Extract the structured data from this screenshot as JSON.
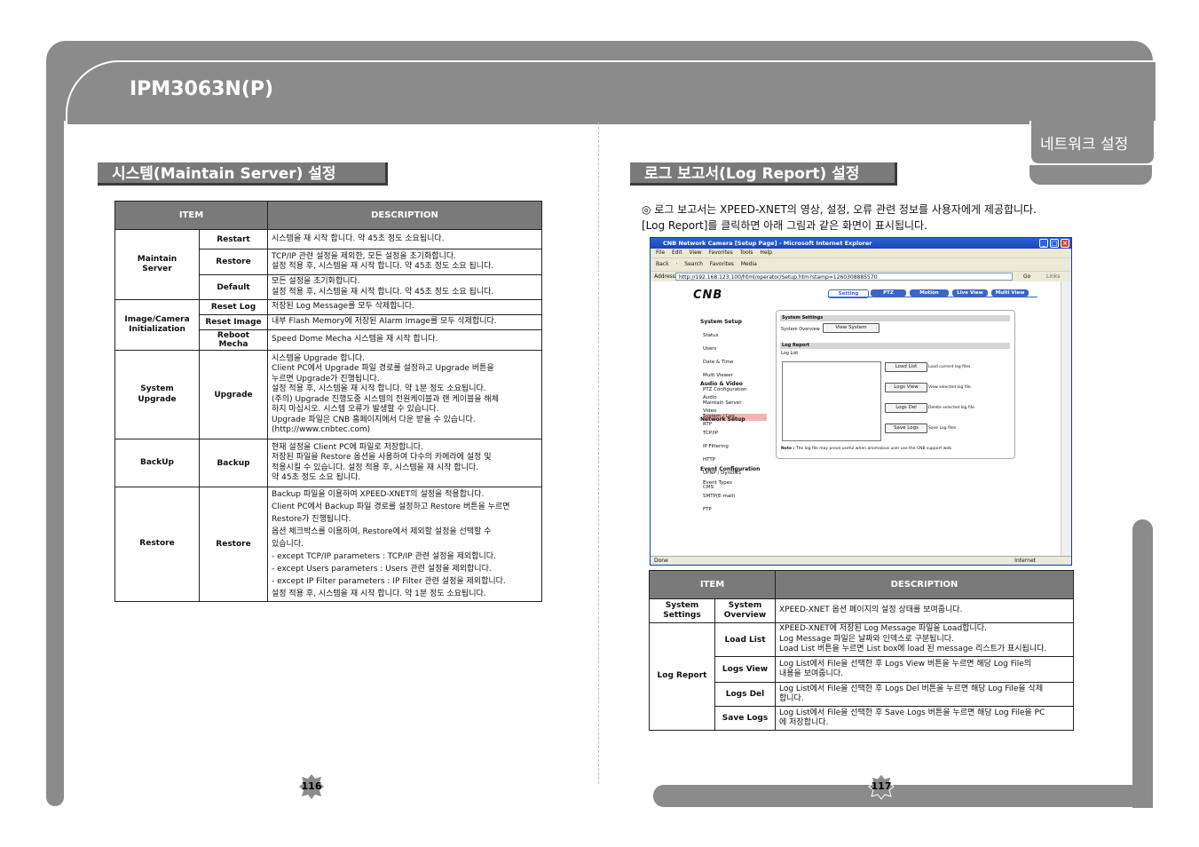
{
  "header": {
    "doc_title": "IPM3063N(P)",
    "tab_label": "네트워크 설정"
  },
  "left": {
    "section_title": "시스템(Maintain Server) 설정",
    "table": {
      "col_item": "ITEM",
      "col_desc": "DESCRIPTION",
      "groups": [
        {
          "group": "Maintain\nServer",
          "rows": [
            {
              "item": "Restart",
              "desc": "시스템을 재 시작 합니다. 약 45초 정도 소요됩니다."
            },
            {
              "item": "Restore",
              "desc": "TCP/IP 관련 설정을 제외한, 모든 설정을 초기화합니다.\n설정 적용 후, 시스템을 재 시작 합니다. 약 45초 정도 소요 됩니다."
            },
            {
              "item": "Default",
              "desc": "모든 설정을 초기화합니다.\n설정 적용 후, 시스템을 재 시작 합니다. 약 45초 정도 소요 됩니다."
            }
          ]
        },
        {
          "group": "Image/Camera\nInitialization",
          "rows": [
            {
              "item": "Reset Log",
              "desc": "저장된 Log Message를 모두 삭제합니다."
            },
            {
              "item": "Reset Image",
              "desc": "내부 Flash Memory에 저장된 Alarm Image를 모두 삭제합니다."
            },
            {
              "item": "Reboot Mecha",
              "desc": "Speed Dome Mecha 시스템을 재 시작 합니다."
            }
          ]
        },
        {
          "group": "System\nUpgrade",
          "rows": [
            {
              "item": "Upgrade",
              "desc": "시스템을 Upgrade 합니다.\nClient PC에서 Upgrade 파일 경로를 설정하고 Upgrade 버튼을\n누르면 Upgrade가 진행됩니다.\n설정 적용 후, 시스템을 재 시작 합니다. 약 1분 정도 소요됩니다.\n(주의) Upgrade 진행도중 시스템의 전원케이블과 랜 케이블을 해체\n하지 마십시오. 시스템 오류가 발생할 수 있습니다.\nUpgrade 파일은 CNB 홈페이지에서 다운 받을 수 있습니다.\n(http://www.cnbtec.com)"
            }
          ]
        },
        {
          "group": "BackUp",
          "rows": [
            {
              "item": "Backup",
              "desc": "현재 설정을 Client PC에 파일로 저장합니다.\n저장된 파일을 Restore 옵션을 사용하여 다수의 카메라에 설정 및\n적용시킬 수 있습니다. 설정 적용 후, 시스템을 재 시작 합니다.\n약 45초 정도 소요 됩니다."
            }
          ]
        },
        {
          "group": "Restore",
          "rows": [
            {
              "item": "Restore",
              "desc": "Backup 파일을 이용하여 XPEED-XNET의 설정을 적용합니다.\nClient PC에서 Backup 파일 경로를 설정하고 Restore 버튼을 누르면\nRestore가 진행됩니다.\n옵션 체크박스를 이용하여, Restore에서 제외할 설정을 선택할 수\n있습니다.\n- except TCP/IP parameters : TCP/IP 관련 설정을 제외합니다.\n- except Users parameters : Users 관련 설정을 제외합니다.\n- except IP Filter parameters : IP Filter 관련 설정을 제외합니다.\n설정 적용 후, 시스템을 재 시작 합니다. 약 1분 정도 소요됩니다."
            }
          ]
        }
      ]
    },
    "page_number": "116"
  },
  "right": {
    "section_title": "로그 보고서(Log Report) 설정",
    "intro": "◎ 로그 보고서는 XPEED-XNET의 영상, 설정, 오류 관련 정보를 사용자에게 제공합니다.\n   [Log Report]를 클릭하면 아래 그림과 같은 화면이 표시됩니다.",
    "browser": {
      "title": "CNB Network Camera [Setup Page] - Microsoft Internet Explorer",
      "menu": "File  Edit  View  Favorites  Tools  Help",
      "toolbar": "Back · Search  Favorites  Media",
      "address_label": "Address",
      "url": "http://192.168.123.100/html/operator/Setup.htm?stamp=1260308885570",
      "go": "Go",
      "links": "Links",
      "logo": "CNB",
      "tabs": [
        "Setting",
        "PTZ",
        "Motion",
        "Live View",
        "Multi View"
      ],
      "sidebar": [
        {
          "heading": "System Setup",
          "items": [
            "Status",
            "Users",
            "Date & Time",
            "Multi Viewer",
            "PTZ Configuration",
            "Maintain Server",
            "System / Log"
          ]
        },
        {
          "heading": "Audio & Video",
          "items": [
            "Audio",
            "Video",
            "RTP"
          ]
        },
        {
          "heading": "Network Setup",
          "items": [
            "TCP/IP",
            "IP Filtering",
            "HTTP",
            "UPNP / DynDNS",
            "CMS"
          ]
        },
        {
          "heading": "Event Configuration",
          "items": [
            "Event Types",
            "SMTP(E-mail)",
            "FTP"
          ]
        }
      ],
      "panel": {
        "system_settings": "System Settings",
        "system_overview": "System Overview",
        "view_system": "View System",
        "log_report": "Log Report",
        "log_list": "Log List",
        "buttons": [
          {
            "label": "Load List",
            "note": "Load current log files."
          },
          {
            "label": "Logs View",
            "note": "View selected log file."
          },
          {
            "label": "Logs Del",
            "note": "Delete selected log file."
          },
          {
            "label": "Save Logs",
            "note": "Save Log files."
          }
        ],
        "note_label": "Note :",
        "note_text": "The log file may prove useful when anomalous user use the CNB support web."
      },
      "status_left": "Done",
      "status_right": "Internet"
    },
    "table": {
      "col_item": "ITEM",
      "col_desc": "DESCRIPTION",
      "groups": [
        {
          "group": "System\nSettings",
          "rows": [
            {
              "item": "System\nOverview",
              "desc": "XPEED-XNET 옵션 페이지의 설정 상태를 보여줍니다."
            }
          ]
        },
        {
          "group": "Log Report",
          "rows": [
            {
              "item": "Load List",
              "desc": "XPEED-XNET에 저장된 Log Message 파일을 Load합니다.\nLog Message 파일은 날짜와 인덱스로 구분됩니다.\nLoad List 버튼을 누르면 List box에 load 된 message 리스트가 표시됩니다."
            },
            {
              "item": "Logs View",
              "desc": "Log List에서 File을 선택한 후 Logs View 버튼을 누르면 해당 Log File의\n내용을 보여줍니다."
            },
            {
              "item": "Logs Del",
              "desc": "Log List에서 File을 선택한 후 Logs Del 버튼을 누르면 해당 Log File을 삭제\n합니다."
            },
            {
              "item": "Save Logs",
              "desc": "Log List에서 File을 선택한 후 Save Logs 버튼을 누르면 해당 Log File을 PC\n에 저장합니다."
            }
          ]
        }
      ]
    },
    "page_number": "117"
  },
  "colors": {
    "frame": "#8b8b8b",
    "header_fill": "#7a7a7a",
    "browser_title": "#1a46b8"
  }
}
